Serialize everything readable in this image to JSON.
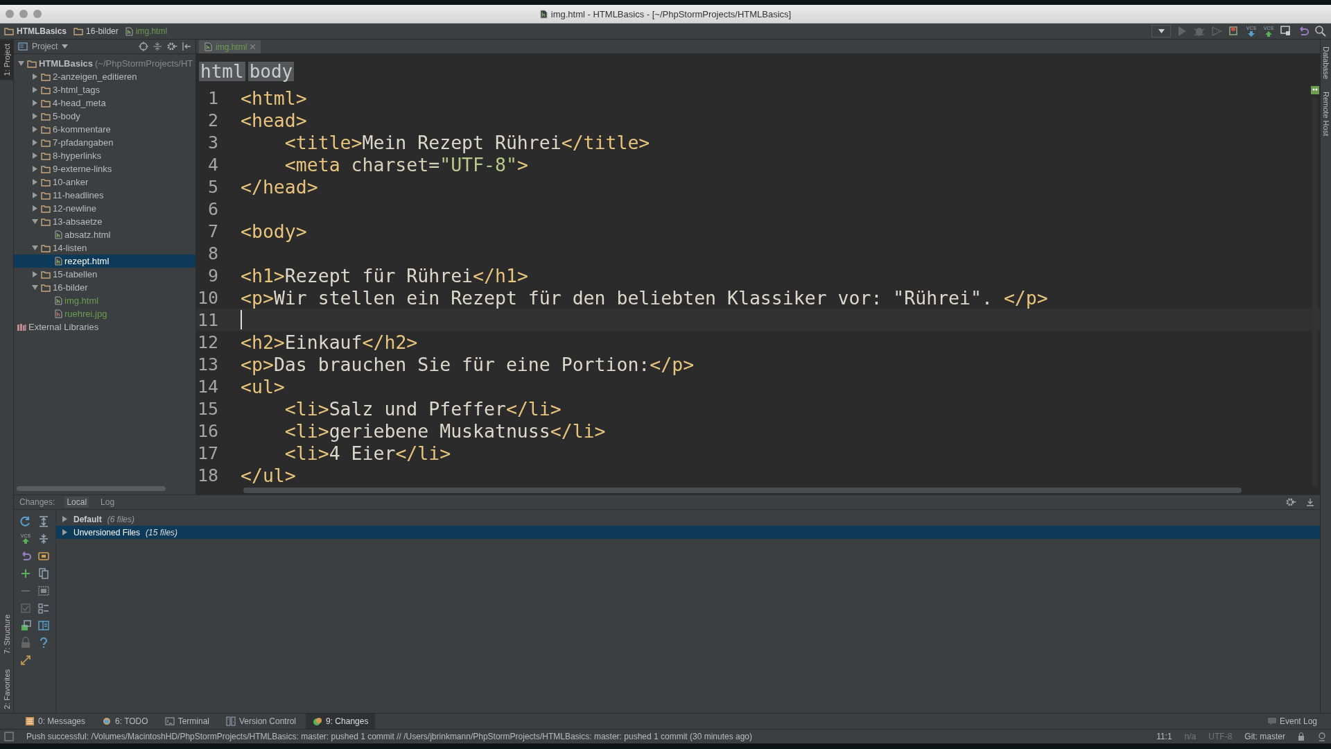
{
  "window": {
    "title": "img.html - HTMLBasics - [~/PhpStormProjects/HTMLBasics]"
  },
  "nav_bar": {
    "crumbs": [
      {
        "kind": "folder",
        "label": "HTMLBasics",
        "bold": true
      },
      {
        "kind": "folder",
        "label": "16-bilder",
        "bold": false
      },
      {
        "kind": "file",
        "label": "img.html",
        "bold": false,
        "color": "#6a9d4f"
      }
    ],
    "toolbar": [
      {
        "kind": "dropdown"
      },
      {
        "kind": "run"
      },
      {
        "kind": "debug"
      },
      {
        "kind": "coverage"
      },
      {
        "kind": "stop"
      },
      {
        "kind": "vcs-update",
        "label": "VCS"
      },
      {
        "kind": "vcs-commit",
        "label": "VCS"
      },
      {
        "kind": "history"
      },
      {
        "kind": "revert"
      },
      {
        "kind": "search"
      }
    ]
  },
  "left_stripe": {
    "top": [
      {
        "label": "1: Project",
        "selected": true
      }
    ],
    "bottom": [
      {
        "label": "7: Structure",
        "selected": false
      },
      {
        "label": "2: Favorites",
        "selected": false
      }
    ]
  },
  "right_stripe": [
    {
      "label": "Database"
    },
    {
      "label": "Remote Host"
    }
  ],
  "project_panel": {
    "title": "Project",
    "tree": [
      {
        "kind": "folder",
        "label": "HTMLBasics",
        "hint": "(~/PhpStormProjects/HT",
        "expanded": true,
        "selected": false,
        "children": [
          {
            "kind": "folder",
            "label": "2-anzeigen_editieren",
            "expanded": false,
            "selected": false
          },
          {
            "kind": "folder",
            "label": "3-html_tags",
            "expanded": false,
            "selected": false
          },
          {
            "kind": "folder",
            "label": "4-head_meta",
            "expanded": false,
            "selected": false
          },
          {
            "kind": "folder",
            "label": "5-body",
            "expanded": false,
            "selected": false
          },
          {
            "kind": "folder",
            "label": "6-kommentare",
            "expanded": false,
            "selected": false
          },
          {
            "kind": "folder",
            "label": "7-pfadangaben",
            "expanded": false,
            "selected": false
          },
          {
            "kind": "folder",
            "label": "8-hyperlinks",
            "expanded": false,
            "selected": false
          },
          {
            "kind": "folder",
            "label": "9-externe-links",
            "expanded": false,
            "selected": false
          },
          {
            "kind": "folder",
            "label": "10-anker",
            "expanded": false,
            "selected": false
          },
          {
            "kind": "folder",
            "label": "11-headlines",
            "expanded": false,
            "selected": false
          },
          {
            "kind": "folder",
            "label": "12-newline",
            "expanded": false,
            "selected": false
          },
          {
            "kind": "folder",
            "label": "13-absaetze",
            "expanded": true,
            "selected": false,
            "children": [
              {
                "kind": "html",
                "label": "absatz.html",
                "selected": false
              }
            ]
          },
          {
            "kind": "folder",
            "label": "14-listen",
            "expanded": true,
            "selected": false,
            "children": [
              {
                "kind": "html",
                "label": "rezept.html",
                "selected": true
              }
            ]
          },
          {
            "kind": "folder",
            "label": "15-tabellen",
            "expanded": false,
            "selected": false
          },
          {
            "kind": "folder",
            "label": "16-bilder",
            "expanded": true,
            "selected": false,
            "children": [
              {
                "kind": "html",
                "label": "img.html",
                "selected": false,
                "color": "#6a9d4f"
              },
              {
                "kind": "image",
                "label": "ruehrei.jpg",
                "selected": false,
                "color": "#6a9d4f"
              }
            ]
          }
        ]
      },
      {
        "kind": "library",
        "label": "External Libraries",
        "selected": false
      }
    ]
  },
  "editor": {
    "tabs": [
      {
        "label": "img.html",
        "selected": true,
        "color": "#6a9d4f"
      }
    ],
    "breadcrumbs": [
      "html",
      "body"
    ],
    "lines": [
      {
        "number": "1",
        "indented": false,
        "current": false,
        "parts": [
          {
            "kind": "tag",
            "text": "<html>"
          }
        ]
      },
      {
        "number": "2",
        "indented": false,
        "current": false,
        "parts": [
          {
            "kind": "tag",
            "text": "<head>"
          }
        ]
      },
      {
        "number": "3",
        "indented": true,
        "current": false,
        "parts": [
          {
            "kind": "tag",
            "text": "<title>"
          },
          {
            "kind": "text",
            "text": "Mein Rezept Rührei"
          },
          {
            "kind": "tag",
            "text": "</title>"
          }
        ]
      },
      {
        "number": "4",
        "indented": true,
        "current": false,
        "parts": [
          {
            "kind": "tag",
            "text": "<meta "
          },
          {
            "kind": "attr",
            "text": "charset="
          },
          {
            "kind": "value",
            "text": "\"UTF-8\""
          },
          {
            "kind": "tag",
            "text": ">"
          }
        ]
      },
      {
        "number": "5",
        "indented": false,
        "current": false,
        "parts": [
          {
            "kind": "tag",
            "text": "</head>"
          }
        ]
      },
      {
        "number": "6",
        "current": false
      },
      {
        "number": "7",
        "indented": false,
        "current": false,
        "parts": [
          {
            "kind": "tag",
            "text": "<body>"
          }
        ]
      },
      {
        "number": "8",
        "current": false
      },
      {
        "number": "9",
        "indented": false,
        "current": false,
        "parts": [
          {
            "kind": "tag",
            "text": "<h1>"
          },
          {
            "kind": "text",
            "text": "Rezept für Rührei"
          },
          {
            "kind": "tag",
            "text": "</h1>"
          }
        ]
      },
      {
        "number": "10",
        "indented": false,
        "current": false,
        "parts": [
          {
            "kind": "tag",
            "text": "<p>"
          },
          {
            "kind": "text",
            "text": "Wir stellen ein Rezept für den beliebten Klassiker vor: \"Rührei\". "
          },
          {
            "kind": "tag",
            "text": "</p>"
          }
        ]
      },
      {
        "number": "11",
        "indented": false,
        "current": true
      },
      {
        "number": "12",
        "indented": false,
        "current": false,
        "parts": [
          {
            "kind": "tag",
            "text": "<h2>"
          },
          {
            "kind": "text",
            "text": "Einkauf"
          },
          {
            "kind": "tag",
            "text": "</h2>"
          }
        ]
      },
      {
        "number": "13",
        "indented": false,
        "current": false,
        "parts": [
          {
            "kind": "tag",
            "text": "<p>"
          },
          {
            "kind": "text",
            "text": "Das brauchen Sie für eine Portion:"
          },
          {
            "kind": "tag",
            "text": "</p>"
          }
        ]
      },
      {
        "number": "14",
        "indented": false,
        "current": false,
        "parts": [
          {
            "kind": "tag",
            "text": "<ul>"
          }
        ]
      },
      {
        "number": "15",
        "indented": true,
        "current": false,
        "parts": [
          {
            "kind": "tag",
            "text": "<li>"
          },
          {
            "kind": "text",
            "text": "Salz und Pfeffer"
          },
          {
            "kind": "tag",
            "text": "</li>"
          }
        ]
      },
      {
        "number": "16",
        "indented": true,
        "current": false,
        "parts": [
          {
            "kind": "tag",
            "text": "<li>"
          },
          {
            "kind": "text",
            "text": "geriebene Muskatnuss"
          },
          {
            "kind": "tag",
            "text": "</li>"
          }
        ]
      },
      {
        "number": "17",
        "indented": true,
        "current": false,
        "parts": [
          {
            "kind": "tag",
            "text": "<li>"
          },
          {
            "kind": "text",
            "text": "4 Eier"
          },
          {
            "kind": "tag",
            "text": "</li>"
          }
        ]
      },
      {
        "number": "18",
        "indented": false,
        "current": false,
        "parts": [
          {
            "kind": "tag",
            "text": "</ul>"
          }
        ]
      }
    ]
  },
  "changes_panel": {
    "title": "Changes:",
    "tabs": [
      {
        "label": "Local",
        "selected": true
      },
      {
        "label": "Log",
        "selected": false
      }
    ],
    "toolbar": [
      {
        "kind": "refresh"
      },
      {
        "kind": "expand-all"
      },
      {
        "kind": "vcs-commit",
        "label": "VCS"
      },
      {
        "kind": "collapse-all"
      },
      {
        "kind": "revert"
      },
      {
        "kind": "show-diff"
      },
      {
        "kind": "add"
      },
      {
        "kind": "copy"
      },
      {
        "kind": "remove"
      },
      {
        "kind": "select"
      },
      {
        "kind": "check"
      },
      {
        "kind": "group"
      },
      {
        "kind": "shelve"
      },
      {
        "kind": "preview"
      },
      {
        "kind": "lock"
      },
      {
        "kind": "help"
      },
      {
        "kind": "expand-window"
      }
    ],
    "changelists": [
      {
        "name": "Default",
        "count": "(6 files)",
        "is_default": true,
        "expanded": false,
        "selected": false
      },
      {
        "name": "Unversioned Files",
        "count": "(15 files)",
        "is_default": false,
        "expanded": false,
        "selected": true
      }
    ]
  },
  "tool_tabs": [
    {
      "kind": "messages",
      "label": "0: Messages",
      "selected": false
    },
    {
      "kind": "todo",
      "label": "6: TODO",
      "selected": false
    },
    {
      "kind": "terminal",
      "label": "Terminal",
      "selected": false
    },
    {
      "kind": "vcs",
      "label": "Version Control",
      "selected": false
    },
    {
      "kind": "changes",
      "label": "9: Changes",
      "selected": true
    }
  ],
  "event_log": "Event Log",
  "status_bar": {
    "message": "Push successful: /Volumes/MacintoshHD/PhpStormProjects/HTMLBasics: master: pushed 1 commit // /Users/jbrinkmann/PhpStormProjects/HTMLBasics: master: pushed 1 commit (30 minutes ago)",
    "position": "11:1",
    "line_separator": "n/a",
    "encoding": "UTF-8",
    "branch": "Git: master"
  }
}
